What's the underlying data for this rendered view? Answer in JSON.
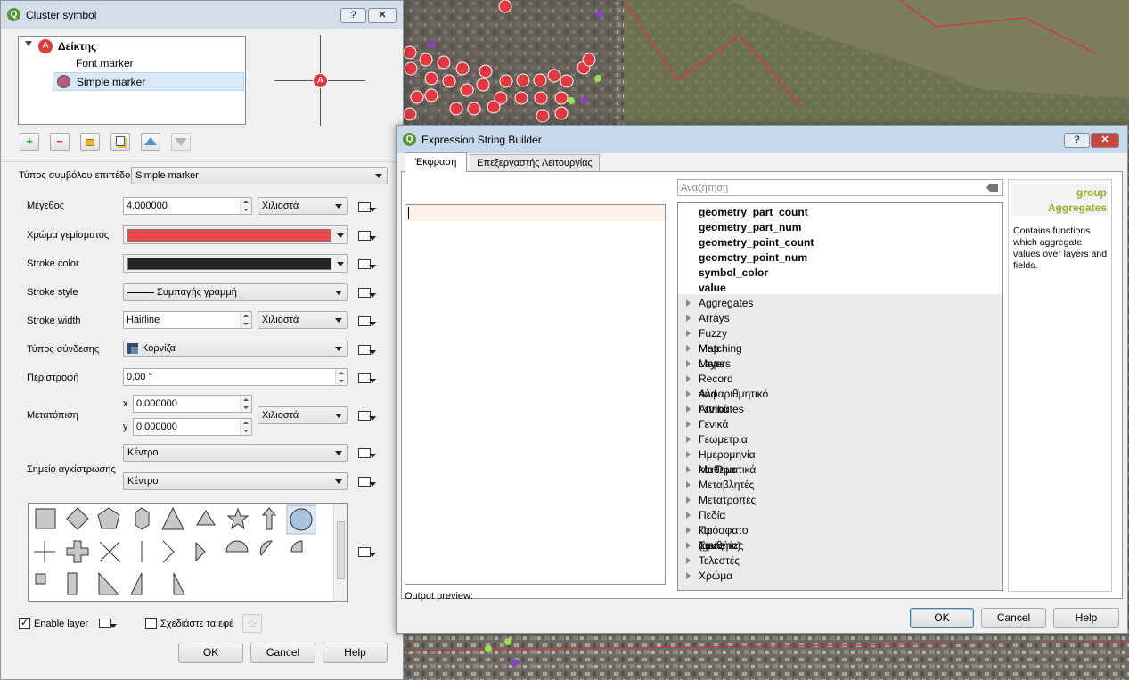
{
  "cluster_dialog": {
    "title": "Cluster symbol",
    "help_btn": "?",
    "close_btn": "✕",
    "tree": [
      {
        "label": "Δείκτης",
        "bold": true
      },
      {
        "label": "Font marker"
      },
      {
        "label": "Simple marker",
        "selected": true
      }
    ],
    "preview_letter": "A",
    "symbol_layer_type_label": "Τύπος συμβόλου επιπέδου",
    "symbol_layer_type_value": "Simple marker",
    "size_label": "Μέγεθος",
    "size_value": "4,000000",
    "size_unit": "Χιλιοστά",
    "fill_color_label": "Χρώμα γεμίσματος",
    "fill_color": "#f04848",
    "stroke_color_label": "Stroke color",
    "stroke_color": "#222222",
    "stroke_style_label": "Stroke style",
    "stroke_style_value": "Συμπαγής γραμμή",
    "stroke_width_label": "Stroke width",
    "stroke_width_value": "Hairline",
    "stroke_width_unit": "Χιλιοστά",
    "join_style_label": "Τύπος σύνδεσης",
    "join_style_value": "Κορνίζα",
    "rotation_label": "Περιστροφή",
    "rotation_value": "0,00 °",
    "offset_label": "Μετατόπιση",
    "offset_x_label": "x",
    "offset_x_value": "0,000000",
    "offset_y_label": "y",
    "offset_y_value": "0,000000",
    "offset_unit": "Χιλιοστά",
    "anchor_label": "Σημείο αγκίστρωσης",
    "anchor_h_value": "Κέντρο",
    "anchor_v_value": "Κέντρο",
    "enable_layer_label": "Enable layer",
    "enable_layer_checked": true,
    "draw_effects_label": "Σχεδιάστε τα εφέ",
    "ok": "OK",
    "cancel": "Cancel",
    "help": "Help"
  },
  "expr_dialog": {
    "title": "Expression String Builder",
    "help_btn": "?",
    "close_btn": "✕",
    "tabs": [
      "Έκφραση",
      "Επεξεργαστής Λειτουργίας"
    ],
    "operators": [
      "=",
      "+",
      "-",
      "/",
      "*",
      "^",
      "||",
      "(",
      ")",
      "'\\n'"
    ],
    "search_placeholder": "Αναζήτηση",
    "functions": [
      "geometry_part_count",
      "geometry_part_num",
      "geometry_point_count",
      "geometry_point_num",
      "symbol_color",
      "value"
    ],
    "groups": [
      "Aggregates",
      "Arrays",
      "Fuzzy Matching",
      "Map Layers",
      "Maps",
      "Record and Attributes",
      "Αλφαριθμητικό",
      "Γενικά",
      "Γενικά",
      "Γεωμετρία",
      "Ημερομηνία και Ώρα",
      "Μαθηματικά",
      "Μεταβλητές",
      "Μετατροπές",
      "Πεδία και Τιμές",
      "Πρόσφατο (generic)",
      "Συνθήκες",
      "Τελεστές",
      "Χρώμα"
    ],
    "help_title_1": "group",
    "help_title_2": "Aggregates",
    "help_text": "Contains functions which aggregate values over layers and fields.",
    "output_preview_label": "Output preview:",
    "ok": "OK",
    "cancel": "Cancel",
    "help": "Help"
  }
}
